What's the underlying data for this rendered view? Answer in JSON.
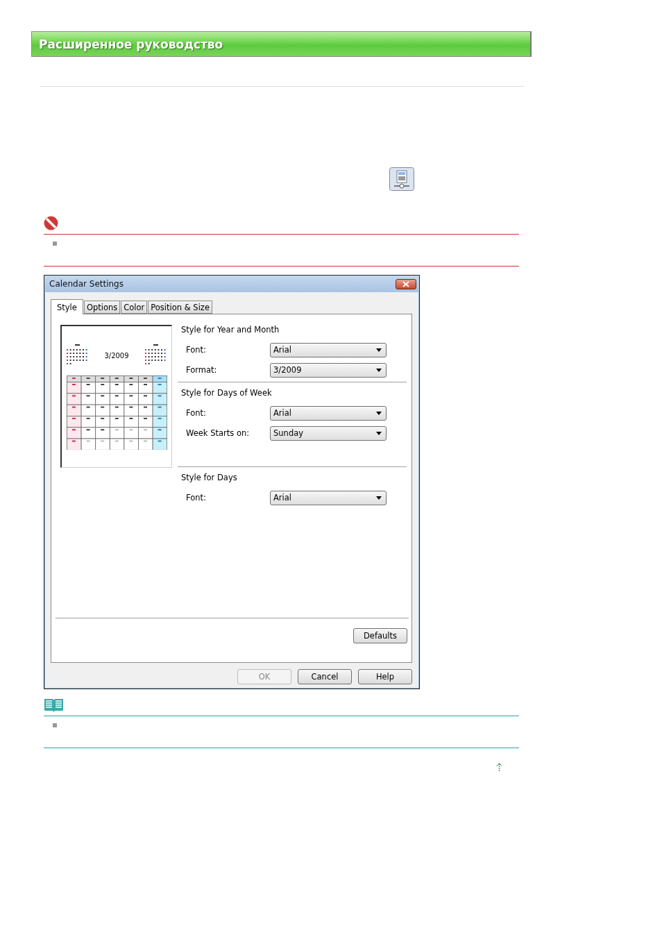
{
  "header": {
    "title": "Расширенное руководство"
  },
  "dialog": {
    "title": "Calendar Settings",
    "tabs": [
      {
        "label": "Style",
        "selected": true
      },
      {
        "label": "Options",
        "selected": false
      },
      {
        "label": "Color",
        "selected": false
      },
      {
        "label": "Position & Size",
        "selected": false
      }
    ],
    "preview": {
      "month": "3/2009"
    },
    "groups": [
      {
        "title": "Style for Year and Month",
        "fields": [
          {
            "label": "Font:",
            "value": "Arial"
          },
          {
            "label": "Format:",
            "value": "3/2009"
          }
        ]
      },
      {
        "title": "Style for Days of Week",
        "fields": [
          {
            "label": "Font:",
            "value": "Arial"
          },
          {
            "label": "Week Starts on:",
            "value": "Sunday"
          }
        ]
      },
      {
        "title": "Style for Days",
        "fields": [
          {
            "label": "Font:",
            "value": "Arial"
          }
        ]
      }
    ],
    "defaults_button": "Defaults",
    "buttons": [
      {
        "label": "OK",
        "disabled": true
      },
      {
        "label": "Cancel",
        "disabled": false
      },
      {
        "label": "Help",
        "disabled": false
      }
    ]
  }
}
